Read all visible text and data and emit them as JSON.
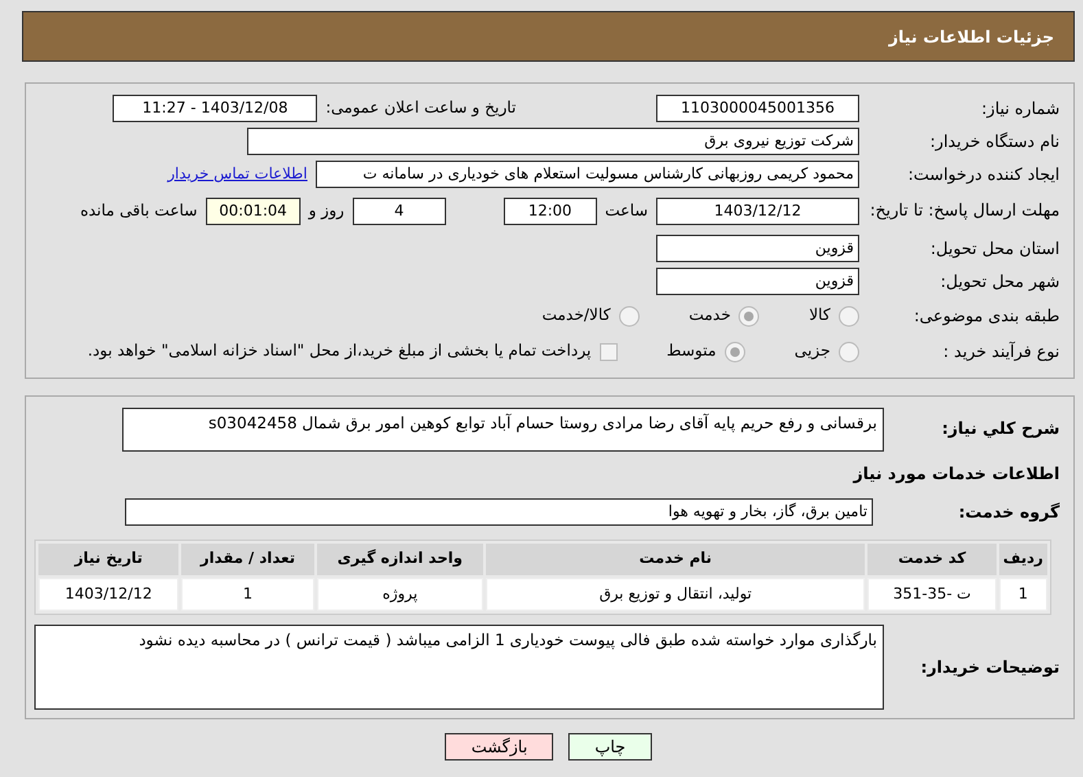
{
  "header": {
    "title": "جزئیات اطلاعات نیاز"
  },
  "details": {
    "need_number": {
      "label": "شماره نیاز:",
      "value": "1103000045001356"
    },
    "announce": {
      "label": "تاریخ و ساعت اعلان عمومی:",
      "value": "1403/12/08 - 11:27"
    },
    "buyer": {
      "label": "نام دستگاه خریدار:",
      "value": "شرکت توزیع نیروی برق"
    },
    "creator": {
      "label": "ایجاد کننده درخواست:",
      "value": "محمود کریمی روزبهانی کارشناس  مسولیت استعلام های خودیاری در سامانه ت",
      "link": "اطلاعات تماس خریدار"
    },
    "deadline": {
      "label": "مهلت ارسال پاسخ: تا تاریخ:",
      "date": "1403/12/12",
      "time_label": "ساعت",
      "time": "12:00",
      "days": "4",
      "days_label": "روز و",
      "remaining": "00:01:04",
      "remaining_label": "ساعت باقی مانده"
    },
    "province": {
      "label": "استان محل تحویل:",
      "value": "قزوین"
    },
    "city": {
      "label": "شهر محل تحویل:",
      "value": "قزوین"
    },
    "category": {
      "label": "طبقه بندی موضوعی:",
      "options": [
        {
          "label": "کالا",
          "selected": false
        },
        {
          "label": "خدمت",
          "selected": true
        },
        {
          "label": "کالا/خدمت",
          "selected": false
        }
      ]
    },
    "process": {
      "label": "نوع فرآیند خرید :",
      "options": [
        {
          "label": "جزیی",
          "selected": false
        },
        {
          "label": "متوسط",
          "selected": true
        }
      ],
      "payment": {
        "checked": false,
        "text": "پرداخت تمام یا بخشی از مبلغ خرید،از محل \"اسناد خزانه اسلامی\" خواهد بود."
      }
    }
  },
  "needs": {
    "description": {
      "label": "شرح کلي نیاز:",
      "value": "برقسانی و رفع حریم پایه آقای رضا مرادی روستا حسام آباد توابع کوهین امور برق شمال s03042458"
    },
    "services_heading": "اطلاعات خدمات مورد نیاز",
    "service_group": {
      "label": "گروه خدمت:",
      "value": "تامین برق، گاز، بخار و تهویه هوا"
    },
    "table": {
      "columns": [
        "ردیف",
        "کد خدمت",
        "نام خدمت",
        "واحد اندازه گیری",
        "تعداد / مقدار",
        "تاریخ نیاز"
      ],
      "rows": [
        [
          "1",
          "ت -35-351",
          "تولید، انتقال و توزیع برق",
          "پروژه",
          "1",
          "1403/12/12"
        ]
      ]
    },
    "buyer_notes": {
      "label": "توضیحات خریدار:",
      "value": "بارگذاری موارد خواسته شده طبق فالی پیوست خودیاری 1 الزامی میباشد ( قیمت ترانس ) در محاسبه دیده نشود"
    }
  },
  "buttons": [
    {
      "label": "چاپ",
      "kind": "print"
    },
    {
      "label": "بازگشت",
      "kind": "back"
    }
  ]
}
